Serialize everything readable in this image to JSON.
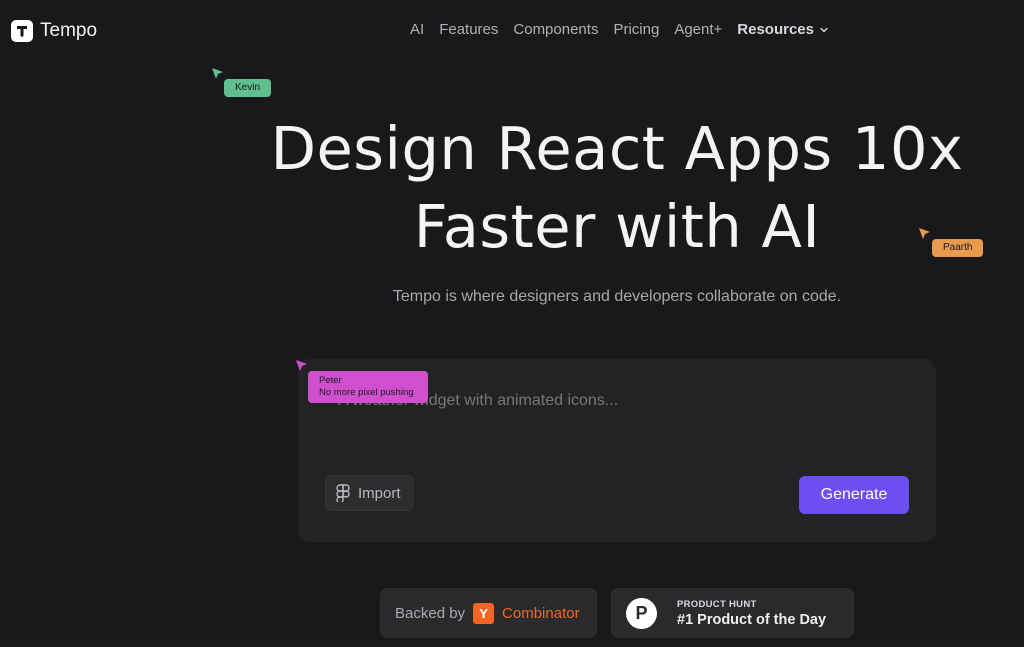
{
  "header": {
    "brand": "Tempo",
    "nav": [
      {
        "label": "AI"
      },
      {
        "label": "Features"
      },
      {
        "label": "Components"
      },
      {
        "label": "Pricing"
      },
      {
        "label": "Agent+"
      },
      {
        "label": "Resources"
      }
    ]
  },
  "hero": {
    "title_line1": "Design React Apps 10x",
    "title_line2": "Faster with AI",
    "subtitle": "Tempo is where designers and developers collaborate on code."
  },
  "cursors": [
    {
      "name": "Kevin",
      "color": "#5fbf8e"
    },
    {
      "name": "Paarth",
      "color": "#e99a4e"
    },
    {
      "name": "Peter",
      "message": "No more pixel pushing",
      "color": "#cf4fcf"
    }
  ],
  "prompt": {
    "placeholder": "A weather widget with animated icons...",
    "import_label": "Import",
    "generate_label": "Generate"
  },
  "badges": {
    "yc_prefix": "Backed by",
    "yc_logo": "Y",
    "yc_name": "Combinator",
    "ph_logo": "P",
    "ph_small": "PRODUCT HUNT",
    "ph_big": "#1 Product of the Day"
  },
  "colors": {
    "background": "#19191b",
    "accent": "#6c4ef2",
    "yc_orange": "#f26522"
  },
  "icons": [
    "tempo-logo-icon",
    "chevron-down-icon",
    "figma-icon",
    "cursor-arrow-icon"
  ]
}
